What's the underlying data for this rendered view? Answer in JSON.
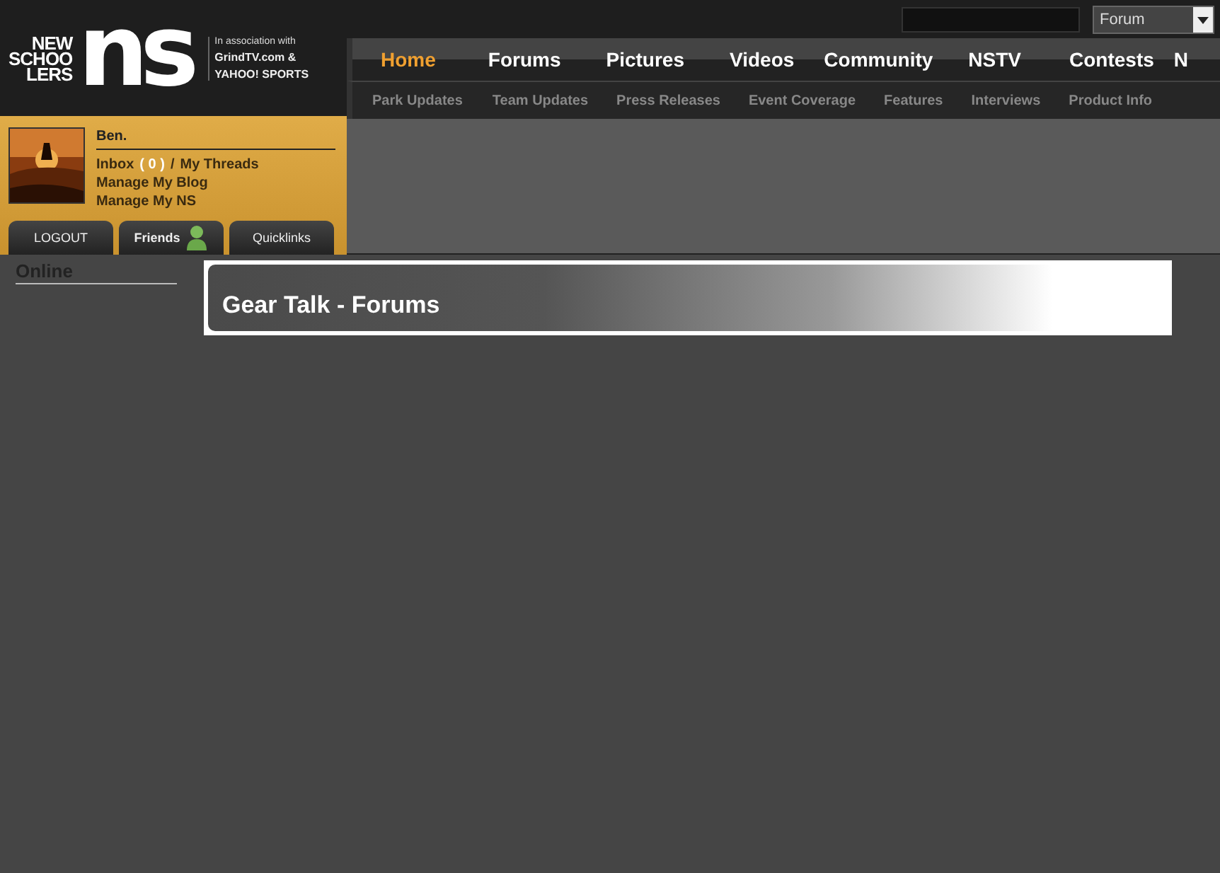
{
  "logo": {
    "words": [
      "NEW",
      "SCHOO",
      "LERS"
    ],
    "mark": "ns"
  },
  "association": {
    "caption": "In association with",
    "partners": [
      "GrindTV.com &",
      "YAHOO! SPORTS"
    ]
  },
  "section_select": {
    "value": "Forum"
  },
  "nav": [
    {
      "label": "Home",
      "selected": true
    },
    {
      "label": "Forums",
      "selected": false
    },
    {
      "label": "Pictures",
      "selected": false
    },
    {
      "label": "Videos",
      "selected": false
    },
    {
      "label": "Community",
      "selected": false
    },
    {
      "label": "NSTV",
      "selected": false
    },
    {
      "label": "Contests",
      "selected": false
    },
    {
      "label": "N",
      "selected": false
    }
  ],
  "subnav": [
    "Park Updates",
    "Team Updates",
    "Press Releases",
    "Event Coverage",
    "Features",
    "Interviews",
    "Product Info"
  ],
  "user": {
    "name": "Ben.",
    "inbox_label": "Inbox",
    "inbox_count": "( 0 )",
    "separator": "/",
    "links": [
      "My Threads",
      "Manage My Blog",
      "Manage My NS"
    ]
  },
  "user_tabs": [
    {
      "label": "LOGOUT",
      "kind": "plain"
    },
    {
      "label": "Friends",
      "kind": "friends"
    },
    {
      "label": "Quicklinks",
      "kind": "plain"
    }
  ],
  "sidebar": {
    "heading": "Online"
  },
  "page_title": "Gear Talk - Forums"
}
